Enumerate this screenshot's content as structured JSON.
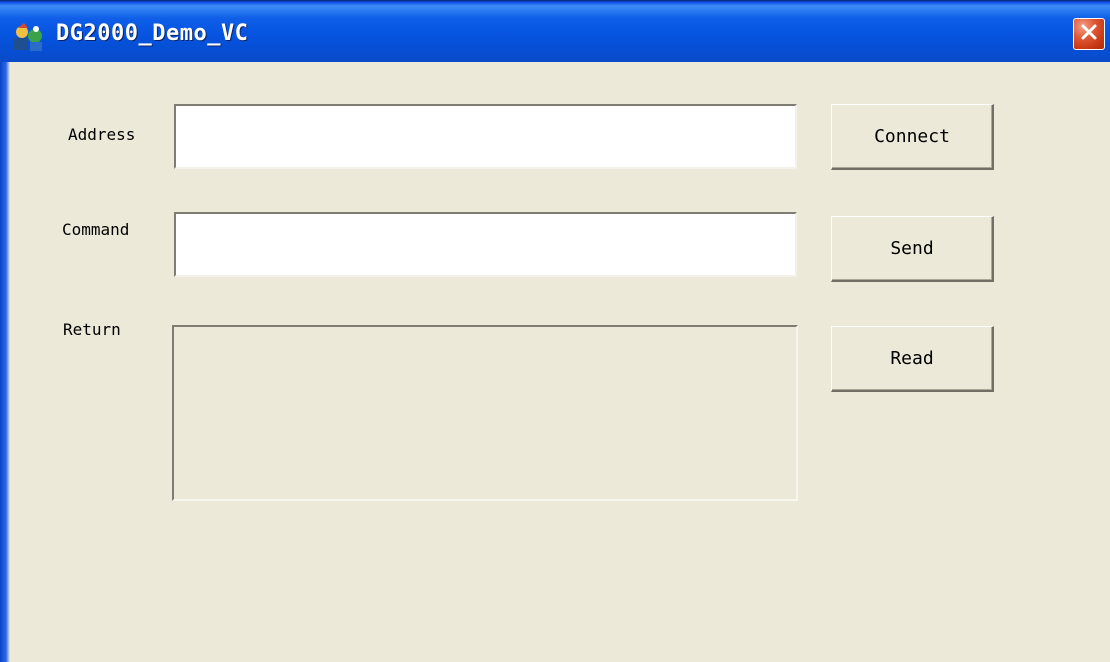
{
  "window": {
    "title": "DG2000_Demo_VC",
    "icon": "app-icon",
    "close_icon": "close-icon",
    "title_bar_color": "#0654e0",
    "background_color": "#ece9d8"
  },
  "form": {
    "address": {
      "label": "Address",
      "value": ""
    },
    "command": {
      "label": "Command",
      "value": ""
    },
    "return": {
      "label": "Return",
      "value": ""
    }
  },
  "buttons": {
    "connect_label": "Connect",
    "send_label": "Send",
    "read_label": "Read"
  }
}
